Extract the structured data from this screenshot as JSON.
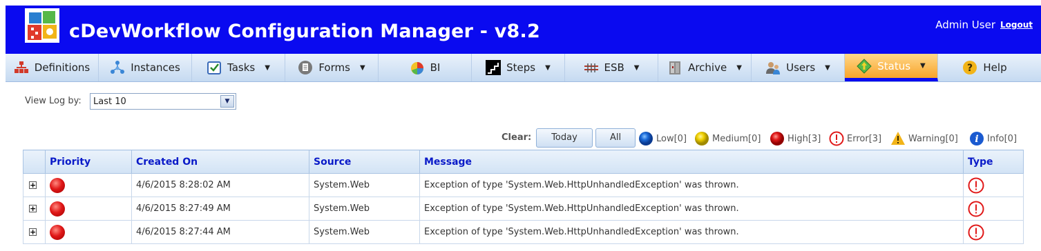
{
  "header": {
    "title": "cDevWorkflow Configuration Manager - v8.2",
    "user": "Admin User",
    "logout": "Logout"
  },
  "nav": [
    {
      "label": "Definitions",
      "icon": "definitions-icon",
      "dropdown": false
    },
    {
      "label": "Instances",
      "icon": "instances-icon",
      "dropdown": false
    },
    {
      "label": "Tasks",
      "icon": "tasks-icon",
      "dropdown": true
    },
    {
      "label": "Forms",
      "icon": "forms-icon",
      "dropdown": true
    },
    {
      "label": "BI",
      "icon": "bi-icon",
      "dropdown": false
    },
    {
      "label": "Steps",
      "icon": "steps-icon",
      "dropdown": true
    },
    {
      "label": "ESB",
      "icon": "esb-icon",
      "dropdown": true
    },
    {
      "label": "Archive",
      "icon": "archive-icon",
      "dropdown": true
    },
    {
      "label": "Users",
      "icon": "users-icon",
      "dropdown": true
    },
    {
      "label": "Status",
      "icon": "status-icon",
      "dropdown": true,
      "active": true
    },
    {
      "label": "Help",
      "icon": "help-icon",
      "dropdown": false
    }
  ],
  "filter": {
    "label": "View Log by:",
    "selected": "Last 10"
  },
  "clear": {
    "label": "Clear:",
    "today": "Today",
    "all": "All"
  },
  "legend": {
    "low": "Low[0]",
    "medium": "Medium[0]",
    "high": "High[3]",
    "error": "Error[3]",
    "warning": "Warning[0]",
    "info": "Info[0]"
  },
  "table": {
    "headers": {
      "priority": "Priority",
      "created": "Created On",
      "source": "Source",
      "message": "Message",
      "type": "Type"
    },
    "rows": [
      {
        "created": "4/6/2015 8:28:02 AM",
        "source": "System.Web",
        "message": "Exception of type 'System.Web.HttpUnhandledException' was thrown.",
        "priority": "high",
        "type": "error"
      },
      {
        "created": "4/6/2015 8:27:49 AM",
        "source": "System.Web",
        "message": "Exception of type 'System.Web.HttpUnhandledException' was thrown.",
        "priority": "high",
        "type": "error"
      },
      {
        "created": "4/6/2015 8:27:44 AM",
        "source": "System.Web",
        "message": "Exception of type 'System.Web.HttpUnhandledException' was thrown.",
        "priority": "high",
        "type": "error"
      }
    ]
  },
  "colors": {
    "header_bg": "#0a0af0",
    "active_tab": "#f8a42a",
    "header_text": "#0a1ac8",
    "error_red": "#e01818"
  }
}
